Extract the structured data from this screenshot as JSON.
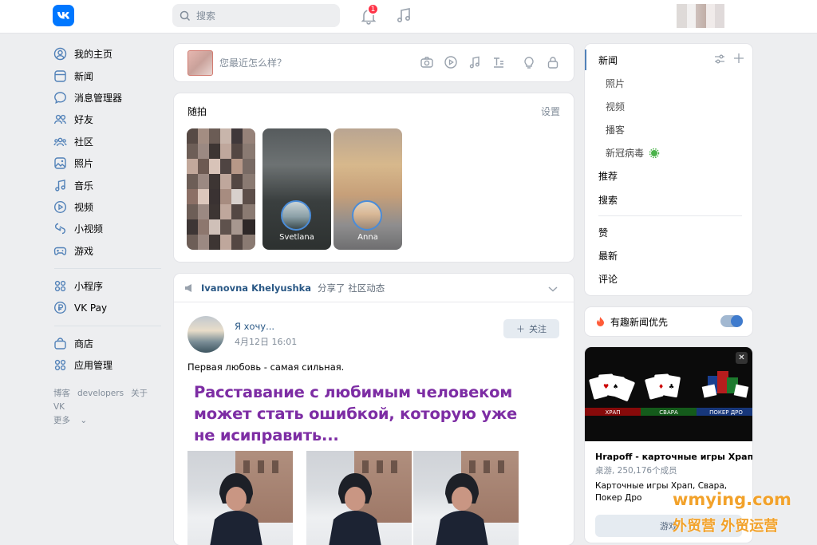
{
  "header": {
    "logo": "vk-logo",
    "search_placeholder": "搜索",
    "notification_count": "1"
  },
  "sidebar": {
    "items": [
      {
        "label": "我的主页",
        "icon": "user-circle-icon"
      },
      {
        "label": "新闻",
        "icon": "news-icon"
      },
      {
        "label": "消息管理器",
        "icon": "message-icon"
      },
      {
        "label": "好友",
        "icon": "friends-icon"
      },
      {
        "label": "社区",
        "icon": "community-icon"
      },
      {
        "label": "照片",
        "icon": "photo-icon"
      },
      {
        "label": "音乐",
        "icon": "music-icon"
      },
      {
        "label": "视频",
        "icon": "video-icon"
      },
      {
        "label": "小视频",
        "icon": "clips-icon"
      },
      {
        "label": "游戏",
        "icon": "game-icon"
      }
    ],
    "items2": [
      {
        "label": "小程序",
        "icon": "apps-icon"
      },
      {
        "label": "VK Pay",
        "icon": "vkpay-icon"
      }
    ],
    "items3": [
      {
        "label": "商店",
        "icon": "shop-icon"
      },
      {
        "label": "应用管理",
        "icon": "apps-manage-icon"
      }
    ],
    "footer": [
      "博客",
      "developers",
      "关于VK",
      "更多"
    ]
  },
  "composer": {
    "placeholder": "您最近怎么样？"
  },
  "stories": {
    "title": "随拍",
    "settings": "设置",
    "items": [
      {
        "name": ""
      },
      {
        "name": "Svetlana"
      },
      {
        "name": "Anna"
      }
    ]
  },
  "post": {
    "shared_by": "Ivanovna Khelyushka",
    "shared_action": "分享了 社区动态",
    "author": "Я хочу...",
    "time": "4月12日 16:01",
    "follow": "关注",
    "text": "Первая любовь - самая сильная.",
    "banner": "Расставание с любимым человеком может стать ошибкой, которую уже не исиправить..."
  },
  "right_nav": {
    "title": "新闻",
    "sub": [
      "照片",
      "视频",
      "播客",
      "新冠病毒"
    ],
    "items": [
      "推荐",
      "搜索"
    ],
    "items2": [
      "赞",
      "最新",
      "评论"
    ]
  },
  "toggle_card": {
    "label": "有趣新闻优先",
    "enabled": true
  },
  "ad": {
    "labels": [
      "ХРАП",
      "СВАРА",
      "ПОКЕР ДРО"
    ],
    "title": "Hrapoff - карточные игры Храп, ...",
    "sub": "桌游, 250,176个成员",
    "desc": "Карточные игры Храп, Свара, Покер Дро",
    "button": "游戏"
  },
  "watermark": {
    "line1": "wmying.com",
    "line2": "外贸营 外贸运营"
  },
  "colors": {
    "accent": "#0077ff",
    "link": "#2a5885",
    "banner": "#7d2da4",
    "badge": "#ff3347"
  }
}
